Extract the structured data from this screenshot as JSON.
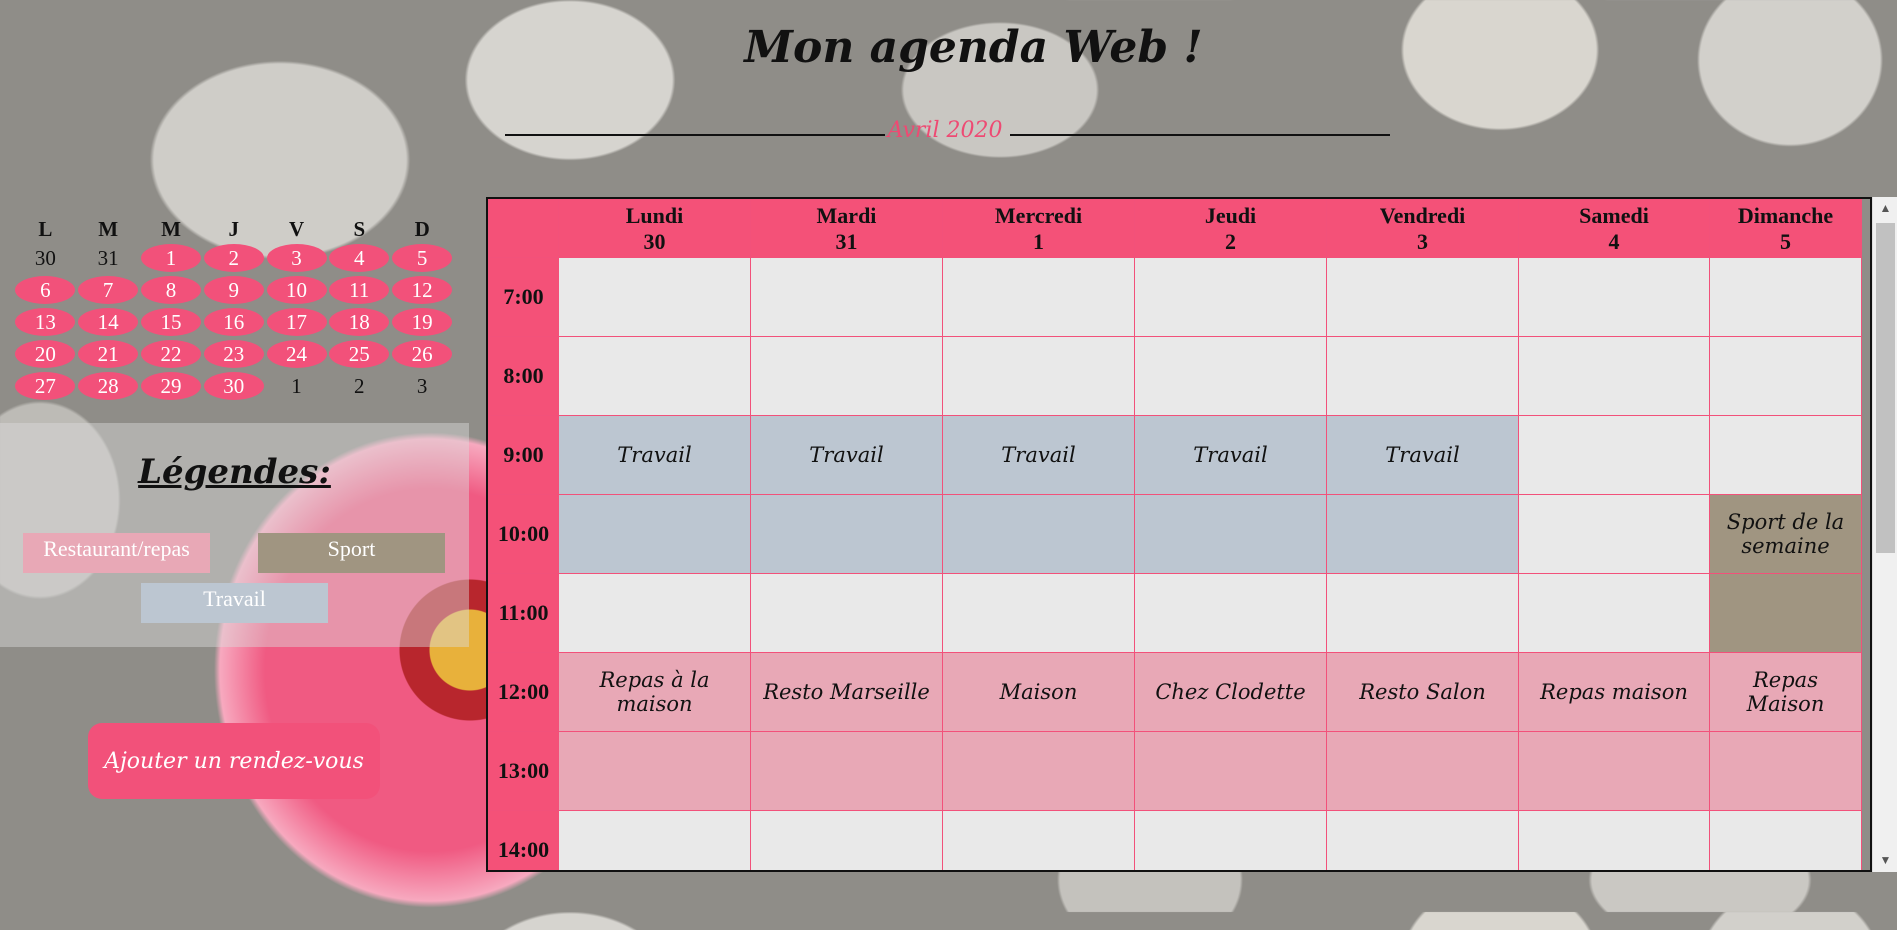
{
  "title": "Mon agenda Web !",
  "month": "Avril 2020",
  "colors": {
    "accent": "#f45178",
    "work": "#bcc6d1",
    "sport": "#a09581",
    "food": "#e8a8b6",
    "empty": "#e9e9e9"
  },
  "mini_calendar": {
    "days": [
      "L",
      "M",
      "M",
      "J",
      "V",
      "S",
      "D"
    ],
    "weeks": [
      [
        {
          "d": "30",
          "cur": false
        },
        {
          "d": "31",
          "cur": false
        },
        {
          "d": "1",
          "cur": true
        },
        {
          "d": "2",
          "cur": true
        },
        {
          "d": "3",
          "cur": true
        },
        {
          "d": "4",
          "cur": true
        },
        {
          "d": "5",
          "cur": true
        }
      ],
      [
        {
          "d": "6",
          "cur": true
        },
        {
          "d": "7",
          "cur": true
        },
        {
          "d": "8",
          "cur": true
        },
        {
          "d": "9",
          "cur": true
        },
        {
          "d": "10",
          "cur": true
        },
        {
          "d": "11",
          "cur": true
        },
        {
          "d": "12",
          "cur": true
        }
      ],
      [
        {
          "d": "13",
          "cur": true
        },
        {
          "d": "14",
          "cur": true
        },
        {
          "d": "15",
          "cur": true
        },
        {
          "d": "16",
          "cur": true
        },
        {
          "d": "17",
          "cur": true
        },
        {
          "d": "18",
          "cur": true
        },
        {
          "d": "19",
          "cur": true
        }
      ],
      [
        {
          "d": "20",
          "cur": true
        },
        {
          "d": "21",
          "cur": true
        },
        {
          "d": "22",
          "cur": true
        },
        {
          "d": "23",
          "cur": true
        },
        {
          "d": "24",
          "cur": true
        },
        {
          "d": "25",
          "cur": true
        },
        {
          "d": "26",
          "cur": true
        }
      ],
      [
        {
          "d": "27",
          "cur": true
        },
        {
          "d": "28",
          "cur": true
        },
        {
          "d": "29",
          "cur": true
        },
        {
          "d": "30",
          "cur": true
        },
        {
          "d": "1",
          "cur": false
        },
        {
          "d": "2",
          "cur": false
        },
        {
          "d": "3",
          "cur": false
        }
      ]
    ]
  },
  "legend": {
    "title": "Légendes:",
    "restaurant": "Restaurant/repas",
    "sport": "Sport",
    "work": "Travail"
  },
  "add_button": "Ajouter un rendez-vous",
  "agenda": {
    "days": [
      {
        "name": "Lundi",
        "num": "30"
      },
      {
        "name": "Mardi",
        "num": "31"
      },
      {
        "name": "Mercredi",
        "num": "1"
      },
      {
        "name": "Jeudi",
        "num": "2"
      },
      {
        "name": "Vendredi",
        "num": "3"
      },
      {
        "name": "Samedi",
        "num": "4"
      },
      {
        "name": "Dimanche",
        "num": "5"
      }
    ],
    "hours": [
      "7:00",
      "8:00",
      "9:00",
      "10:00",
      "11:00",
      "12:00",
      "13:00",
      "14:00"
    ],
    "events": {
      "work_label": "Travail",
      "sport_label": "Sport de la semaine",
      "lunch": [
        "Repas à la maison",
        "Resto Marseille",
        "Maison",
        "Chez Clodette",
        "Resto Salon",
        "Repas maison",
        "Repas Maison"
      ]
    }
  }
}
